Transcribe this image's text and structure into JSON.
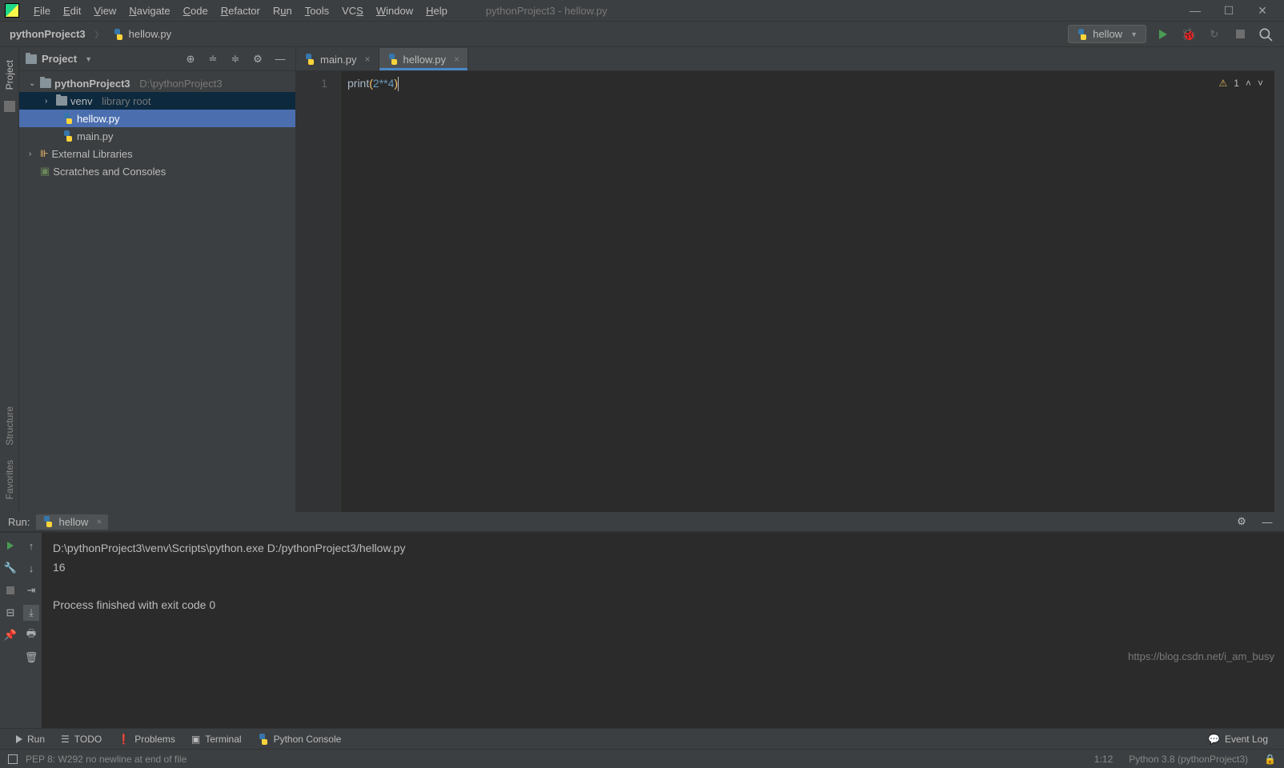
{
  "window": {
    "title": "pythonProject3 - hellow.py"
  },
  "menu": [
    "File",
    "Edit",
    "View",
    "Navigate",
    "Code",
    "Refactor",
    "Run",
    "Tools",
    "VCS",
    "Window",
    "Help"
  ],
  "breadcrumb": {
    "project": "pythonProject3",
    "file": "hellow.py"
  },
  "run_config": {
    "name": "hellow"
  },
  "project_tree": {
    "panel_label": "Project",
    "root": {
      "name": "pythonProject3",
      "path": "D:\\pythonProject3"
    },
    "venv": {
      "name": "venv",
      "hint": "library root"
    },
    "files": [
      "hellow.py",
      "main.py"
    ],
    "ext_lib": "External Libraries",
    "scratches": "Scratches and Consoles"
  },
  "editor_tabs": [
    {
      "name": "main.py",
      "active": false
    },
    {
      "name": "hellow.py",
      "active": true
    }
  ],
  "code": {
    "line_no": "1",
    "fn": "print",
    "open": "(",
    "arg": "2**4",
    "close": ")",
    "warnings": "1"
  },
  "run_panel": {
    "label": "Run:",
    "tab": "hellow",
    "cmd": "D:\\pythonProject3\\venv\\Scripts\\python.exe D:/pythonProject3/hellow.py",
    "output": "16",
    "exit": "Process finished with exit code 0"
  },
  "bottom_tabs": {
    "run": "Run",
    "todo": "TODO",
    "problems": "Problems",
    "terminal": "Terminal",
    "pyconsole": "Python Console",
    "eventlog": "Event Log"
  },
  "left_rail": {
    "project": "Project",
    "structure": "Structure",
    "favorites": "Favorites"
  },
  "status": {
    "msg": "PEP 8: W292 no newline at end of file",
    "pos": "1:12",
    "interpreter": "Python 3.8 (pythonProject3)"
  },
  "watermark": "https://blog.csdn.net/i_am_busy"
}
